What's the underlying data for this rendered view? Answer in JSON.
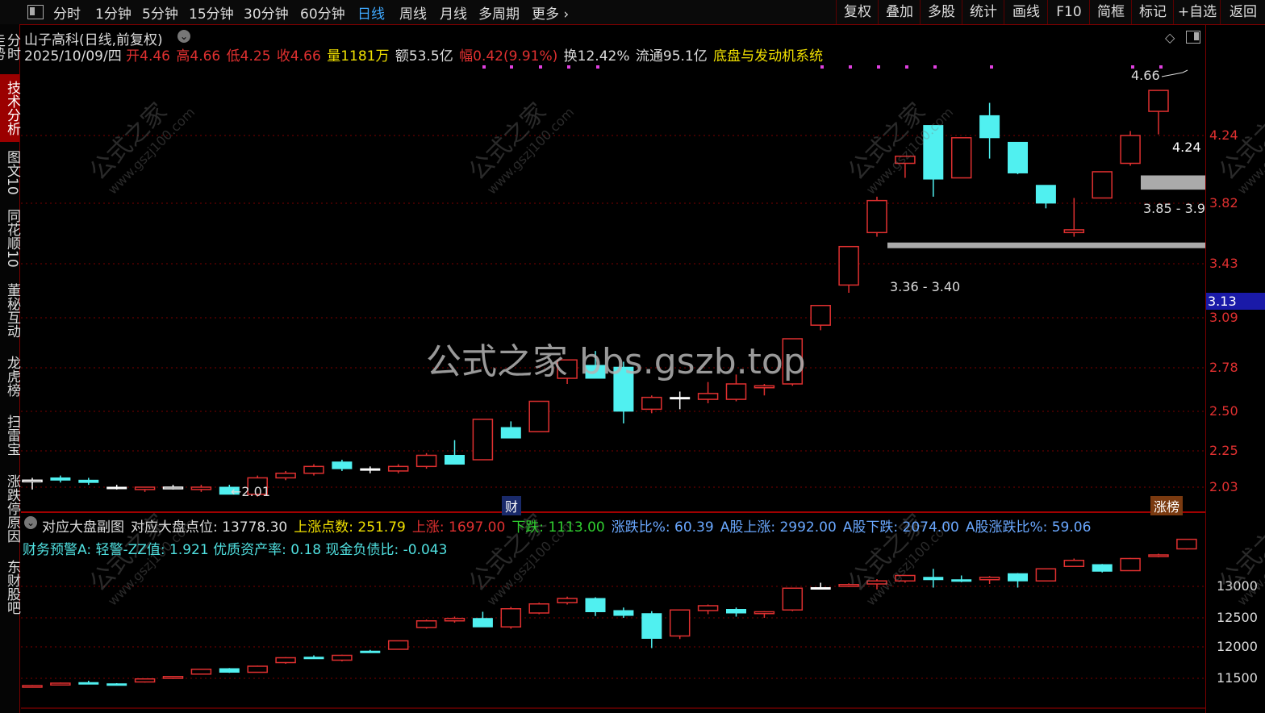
{
  "toolbar": {
    "left_items": [
      "分时",
      "1分钟",
      "5分钟",
      "15分钟",
      "30分钟",
      "60分钟",
      "日线",
      "周线",
      "月线",
      "多周期",
      "更多"
    ],
    "active": "日线",
    "right_items": [
      "复权",
      "叠加",
      "多股",
      "统计",
      "画线",
      "F10",
      "简框",
      "标记",
      "+自选",
      "返回"
    ]
  },
  "sidebar": [
    "分时走势",
    "技术分析",
    "图文10",
    "同花顺10",
    "董秘互动",
    "龙虎榜",
    "扫雷宝",
    "涨跌停原因",
    "东财股吧"
  ],
  "sidebar_active": "技术分析",
  "header": {
    "title": "山子高科(日线,前复权)",
    "date": "2025/10/09/四",
    "open_label": "开",
    "open": "4.46",
    "high_label": "高",
    "high": "4.66",
    "low_label": "低",
    "low": "4.25",
    "close_label": "收",
    "close": "4.66",
    "vol_label": "量",
    "vol": "1181万",
    "amt_label": "额",
    "amt": "53.5亿",
    "chg_label": "幅",
    "chg": "0.42(9.91%)",
    "turn_label": "换",
    "turn": "12.42%",
    "float_label": "流通",
    "float": "95.1亿",
    "system": "底盘与发动机系统"
  },
  "main_axis": [
    "4.24",
    "3.82",
    "3.43",
    "3.09",
    "2.78",
    "2.50",
    "2.25",
    "2.03"
  ],
  "price_marker": "3.13",
  "annotations": {
    "high_label": "4.66",
    "last_label": "4.24",
    "zone1": "3.85 - 3.9",
    "zone2": "3.36 - 3.40",
    "low_label": "2.01",
    "cai_badge": "财",
    "zhang_badge": "涨榜"
  },
  "watermark": {
    "center": "公式之家 bbs.gszb.top",
    "tile_cn": "公式之家",
    "tile_en": "www.gszj100.com"
  },
  "sub": {
    "line1": [
      {
        "text": "对应大盘副图",
        "color": "#dddddd"
      },
      {
        "text": "对应大盘点位: 13778.30",
        "color": "#dddddd"
      },
      {
        "text": "上涨点数: 251.79",
        "color": "#f0e000"
      },
      {
        "text": "上涨: 1697.00",
        "color": "#e03030"
      },
      {
        "text": "下跌: 1113.00",
        "color": "#30d030"
      },
      {
        "text": "涨跌比%: 60.39",
        "color": "#6aa8ff"
      },
      {
        "text": "A股上涨: 2992.00",
        "color": "#6aa8ff"
      },
      {
        "text": "A股下跌: 2074.00",
        "color": "#6aa8ff"
      },
      {
        "text": "A股涨跌比%: 59.06",
        "color": "#6aa8ff"
      }
    ],
    "line2": "财务预警A: 轻警-ZZ值: 1.921 优质资产率: 0.18 现金负债比: -0.043",
    "axis": [
      "13000",
      "12500",
      "12000",
      "11500"
    ]
  },
  "colors": {
    "up": "#e03030",
    "down": "#50f0f0",
    "flat": "#ffffff",
    "grid": "#7a0000"
  },
  "chart_data": {
    "type": "candlestick",
    "title": "山子高科(日线,前复权)",
    "price_candles": [
      {
        "o": 2.06,
        "h": 2.07,
        "l": 2.02,
        "c": 2.06,
        "up": true
      },
      {
        "o": 2.07,
        "h": 2.08,
        "l": 2.05,
        "c": 2.06,
        "up": false
      },
      {
        "o": 2.06,
        "h": 2.07,
        "l": 2.04,
        "c": 2.05,
        "up": false
      },
      {
        "o": 2.03,
        "h": 2.04,
        "l": 2.02,
        "c": 2.03,
        "up": false
      },
      {
        "o": 2.02,
        "h": 2.03,
        "l": 2.01,
        "c": 2.03,
        "up": true
      },
      {
        "o": 2.03,
        "h": 2.04,
        "l": 2.02,
        "c": 2.03,
        "up": true
      },
      {
        "o": 2.02,
        "h": 2.04,
        "l": 2.01,
        "c": 2.03,
        "up": true
      },
      {
        "o": 2.03,
        "h": 2.04,
        "l": 2.0,
        "c": 2.0,
        "up": false
      },
      {
        "o": 2.0,
        "h": 2.08,
        "l": 1.99,
        "c": 2.07,
        "up": true
      },
      {
        "o": 2.07,
        "h": 2.1,
        "l": 2.06,
        "c": 2.09,
        "up": true
      },
      {
        "o": 2.09,
        "h": 2.13,
        "l": 2.08,
        "c": 2.12,
        "up": true
      },
      {
        "o": 2.14,
        "h": 2.15,
        "l": 2.1,
        "c": 2.11,
        "up": false
      },
      {
        "o": 2.11,
        "h": 2.12,
        "l": 2.09,
        "c": 2.11,
        "up": false
      },
      {
        "o": 2.1,
        "h": 2.13,
        "l": 2.09,
        "c": 2.12,
        "up": true
      },
      {
        "o": 2.12,
        "h": 2.18,
        "l": 2.11,
        "c": 2.17,
        "up": true
      },
      {
        "o": 2.17,
        "h": 2.24,
        "l": 2.14,
        "c": 2.13,
        "up": false
      },
      {
        "o": 2.15,
        "h": 2.34,
        "l": 2.15,
        "c": 2.34,
        "up": true
      },
      {
        "o": 2.3,
        "h": 2.33,
        "l": 2.25,
        "c": 2.25,
        "up": false
      },
      {
        "o": 2.28,
        "h": 2.43,
        "l": 2.28,
        "c": 2.43,
        "up": true
      },
      {
        "o": 2.55,
        "h": 2.6,
        "l": 2.52,
        "c": 2.65,
        "up": true
      },
      {
        "o": 2.62,
        "h": 2.7,
        "l": 2.55,
        "c": 2.55,
        "up": false
      },
      {
        "o": 2.61,
        "h": 2.64,
        "l": 2.32,
        "c": 2.38,
        "up": false
      },
      {
        "o": 2.39,
        "h": 2.46,
        "l": 2.37,
        "c": 2.45,
        "up": true
      },
      {
        "o": 2.45,
        "h": 2.48,
        "l": 2.39,
        "c": 2.45,
        "up": false
      },
      {
        "o": 2.44,
        "h": 2.53,
        "l": 2.42,
        "c": 2.47,
        "up": true
      },
      {
        "o": 2.44,
        "h": 2.57,
        "l": 2.43,
        "c": 2.52,
        "up": true
      },
      {
        "o": 2.51,
        "h": 2.52,
        "l": 2.46,
        "c": 2.5,
        "up": true
      },
      {
        "o": 2.52,
        "h": 2.77,
        "l": 2.51,
        "c": 2.77,
        "up": true
      },
      {
        "o": 2.85,
        "h": 2.97,
        "l": 2.82,
        "c": 2.97,
        "up": true
      },
      {
        "o": 3.1,
        "h": 3.36,
        "l": 3.05,
        "c": 3.36,
        "up": true
      },
      {
        "o": 3.46,
        "h": 3.73,
        "l": 3.43,
        "c": 3.7,
        "up": true
      },
      {
        "o": 4.0,
        "h": 4.06,
        "l": 3.88,
        "c": 4.06,
        "up": true
      },
      {
        "o": 4.33,
        "h": 4.33,
        "l": 3.73,
        "c": 3.87,
        "up": false
      },
      {
        "o": 3.88,
        "h": 4.22,
        "l": 3.88,
        "c": 4.22,
        "up": true
      },
      {
        "o": 4.42,
        "h": 4.54,
        "l": 4.04,
        "c": 4.22,
        "up": false
      },
      {
        "o": 4.18,
        "h": 4.18,
        "l": 3.91,
        "c": 3.92,
        "up": false
      },
      {
        "o": 3.82,
        "h": 3.82,
        "l": 3.64,
        "c": 3.68,
        "up": false
      },
      {
        "o": 3.48,
        "h": 3.72,
        "l": 3.43,
        "c": 3.46,
        "up": true
      },
      {
        "o": 3.72,
        "h": 3.93,
        "l": 3.72,
        "c": 3.93,
        "up": true
      },
      {
        "o": 4.0,
        "h": 4.28,
        "l": 3.98,
        "c": 4.24,
        "up": true
      },
      {
        "o": 4.46,
        "h": 4.66,
        "l": 4.25,
        "c": 4.66,
        "up": true
      }
    ],
    "index_candles": [
      {
        "o": 11350,
        "h": 11370,
        "l": 11340,
        "c": 11360,
        "up": true
      },
      {
        "o": 11370,
        "h": 11410,
        "l": 11360,
        "c": 11400,
        "up": true
      },
      {
        "o": 11400,
        "h": 11440,
        "l": 11380,
        "c": 11410,
        "up": false
      },
      {
        "o": 11380,
        "h": 11400,
        "l": 11360,
        "c": 11390,
        "up": false
      },
      {
        "o": 11420,
        "h": 11480,
        "l": 11410,
        "c": 11470,
        "up": true
      },
      {
        "o": 11480,
        "h": 11520,
        "l": 11470,
        "c": 11510,
        "up": true
      },
      {
        "o": 11550,
        "h": 11640,
        "l": 11540,
        "c": 11630,
        "up": true
      },
      {
        "o": 11640,
        "h": 11650,
        "l": 11570,
        "c": 11580,
        "up": false
      },
      {
        "o": 11580,
        "h": 11690,
        "l": 11580,
        "c": 11680,
        "up": true
      },
      {
        "o": 11740,
        "h": 11830,
        "l": 11720,
        "c": 11820,
        "up": true
      },
      {
        "o": 11830,
        "h": 11860,
        "l": 11800,
        "c": 11820,
        "up": false
      },
      {
        "o": 11780,
        "h": 11870,
        "l": 11760,
        "c": 11860,
        "up": true
      },
      {
        "o": 11930,
        "h": 11950,
        "l": 11900,
        "c": 11920,
        "up": false
      },
      {
        "o": 11960,
        "h": 12100,
        "l": 11960,
        "c": 12100,
        "up": true
      },
      {
        "o": 12320,
        "h": 12450,
        "l": 12300,
        "c": 12430,
        "up": true
      },
      {
        "o": 12430,
        "h": 12500,
        "l": 12400,
        "c": 12470,
        "up": true
      },
      {
        "o": 12470,
        "h": 12580,
        "l": 12400,
        "c": 12330,
        "up": false
      },
      {
        "o": 12330,
        "h": 12660,
        "l": 12300,
        "c": 12630,
        "up": true
      },
      {
        "o": 12560,
        "h": 12730,
        "l": 12540,
        "c": 12710,
        "up": true
      },
      {
        "o": 12730,
        "h": 12830,
        "l": 12700,
        "c": 12800,
        "up": true
      },
      {
        "o": 12800,
        "h": 12820,
        "l": 12510,
        "c": 12580,
        "up": false
      },
      {
        "o": 12600,
        "h": 12650,
        "l": 12480,
        "c": 12520,
        "up": false
      },
      {
        "o": 12550,
        "h": 12590,
        "l": 11980,
        "c": 12140,
        "up": false
      },
      {
        "o": 12180,
        "h": 12620,
        "l": 12130,
        "c": 12610,
        "up": true
      },
      {
        "o": 12600,
        "h": 12700,
        "l": 12540,
        "c": 12680,
        "up": true
      },
      {
        "o": 12620,
        "h": 12650,
        "l": 12500,
        "c": 12560,
        "up": false
      },
      {
        "o": 12550,
        "h": 12590,
        "l": 12480,
        "c": 12580,
        "up": true
      },
      {
        "o": 12610,
        "h": 12980,
        "l": 12590,
        "c": 12970,
        "up": true
      },
      {
        "o": 12980,
        "h": 13060,
        "l": 12950,
        "c": 12980,
        "up": false
      },
      {
        "o": 13000,
        "h": 13050,
        "l": 12990,
        "c": 13030,
        "up": true
      },
      {
        "o": 13040,
        "h": 13120,
        "l": 12950,
        "c": 13090,
        "up": true
      },
      {
        "o": 13090,
        "h": 13190,
        "l": 13060,
        "c": 13180,
        "up": true
      },
      {
        "o": 13150,
        "h": 13290,
        "l": 12980,
        "c": 13110,
        "up": false
      },
      {
        "o": 13110,
        "h": 13180,
        "l": 13070,
        "c": 13100,
        "up": false
      },
      {
        "o": 13110,
        "h": 13170,
        "l": 13040,
        "c": 13150,
        "up": true
      },
      {
        "o": 13210,
        "h": 13220,
        "l": 12980,
        "c": 13090,
        "up": false
      },
      {
        "o": 13090,
        "h": 13300,
        "l": 13080,
        "c": 13290,
        "up": true
      },
      {
        "o": 13330,
        "h": 13460,
        "l": 13330,
        "c": 13430,
        "up": true
      },
      {
        "o": 13360,
        "h": 13370,
        "l": 13230,
        "c": 13250,
        "up": false
      },
      {
        "o": 13260,
        "h": 13470,
        "l": 13260,
        "c": 13460,
        "up": true
      },
      {
        "o": 13510,
        "h": 13540,
        "l": 13480,
        "c": 13520,
        "up": true
      },
      {
        "o": 13620,
        "h": 13780,
        "l": 13610,
        "c": 13778,
        "up": true
      }
    ]
  }
}
